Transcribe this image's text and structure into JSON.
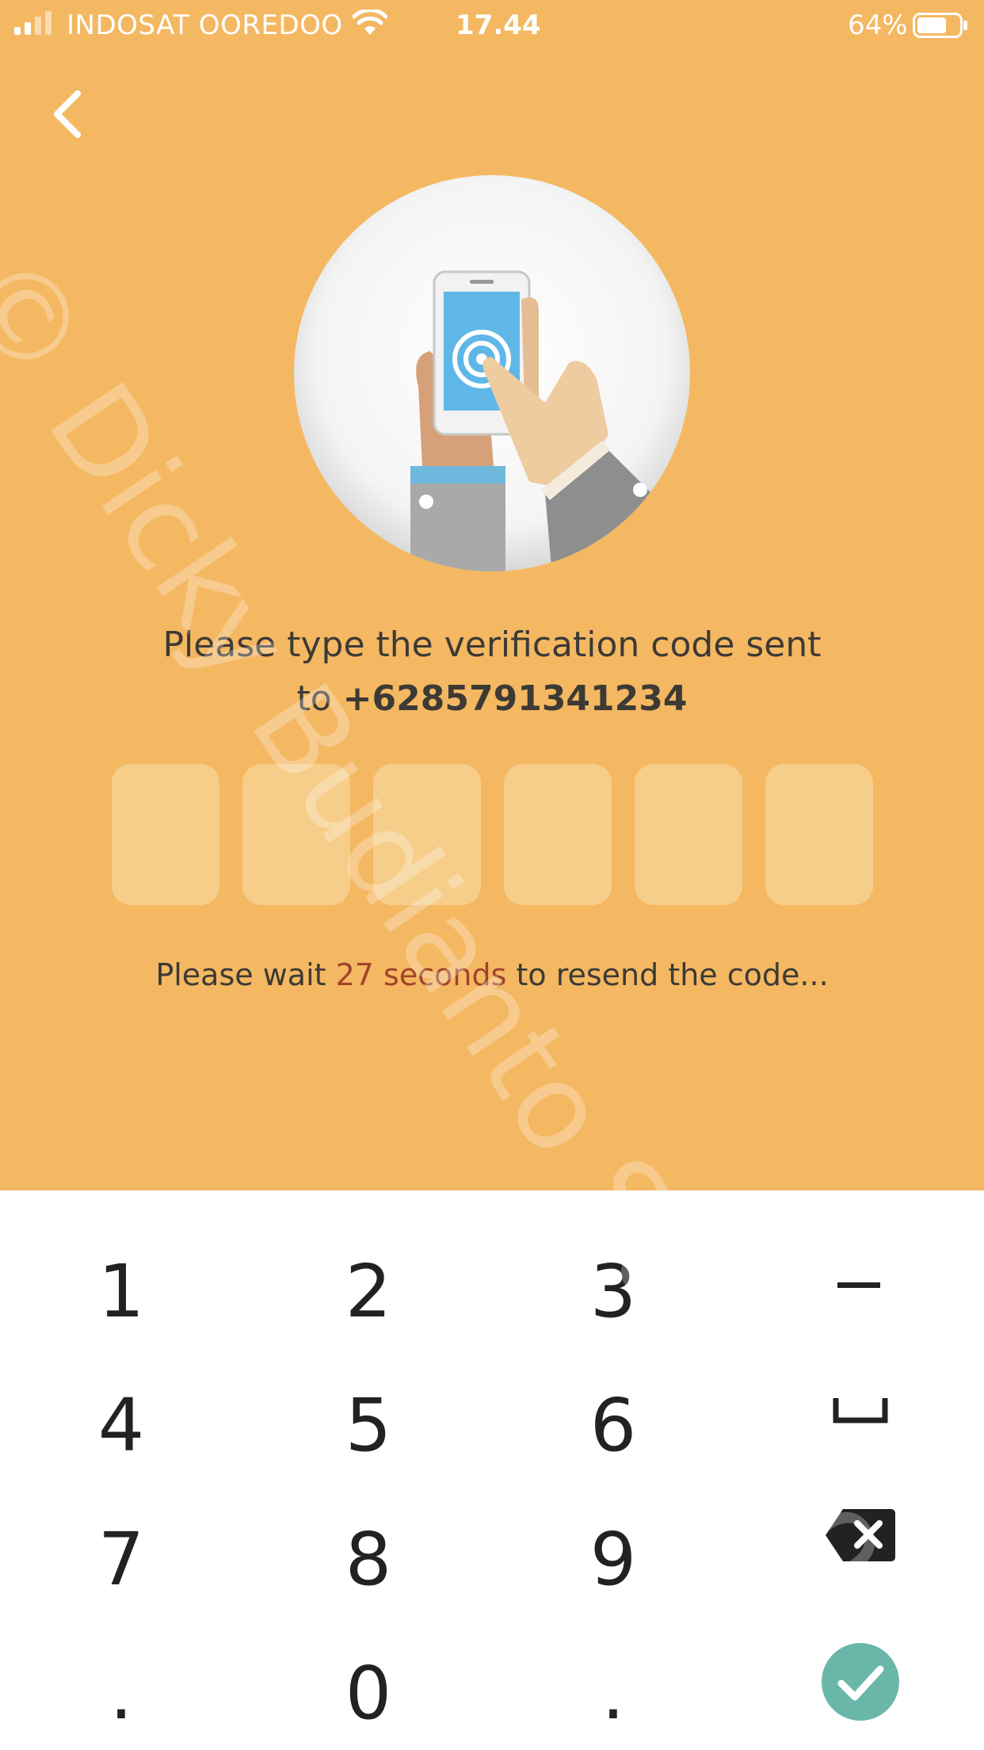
{
  "status": {
    "carrier": "INDOSAT OOREDOO",
    "time": "17.44",
    "battery": "64%"
  },
  "nav": {
    "back_icon": "chevron-left-icon"
  },
  "illustration": {
    "icon": "hand-holding-phone-illustration"
  },
  "message": {
    "line1": "Please type the verification code sent",
    "prefix": "to ",
    "phone": "+6285791341234"
  },
  "otp": {
    "digits": [
      "",
      "",
      "",
      "",
      "",
      ""
    ]
  },
  "resend": {
    "before": "Please wait ",
    "seconds": "27 seconds",
    "after": " to resend the code..."
  },
  "keypad": {
    "keys": [
      "1",
      "2",
      "3",
      "4",
      "5",
      "6",
      "7",
      "8",
      "9",
      ".",
      "0",
      "."
    ],
    "function_keys": [
      "minus-icon",
      "space-icon",
      "backspace-icon",
      "check-icon"
    ]
  },
  "watermark": "© Dicky Budianto Sugiono",
  "colors": {
    "background": "#f4b862",
    "otp_box": "#f6cd89",
    "accent_seconds": "#a0432a",
    "confirm": "#6ab7a9"
  }
}
